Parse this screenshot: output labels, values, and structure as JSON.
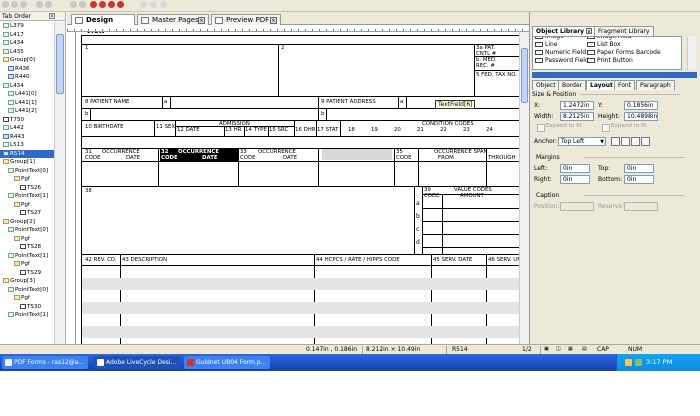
{
  "left_panel": {
    "tab": "Tab Order",
    "items": [
      "L379",
      "L417",
      "L434",
      "L435",
      "Group[0]",
      "R436",
      "R440",
      "L434",
      "L441[0]",
      "L441[1]",
      "L441[2]",
      "T750",
      "L442",
      "R443",
      "L513",
      "R514",
      "Group[1]",
      "PointText[0]",
      "Pgf",
      "TS26",
      "PointText[1]",
      "Pgf",
      "TS27",
      "Group[2]",
      "PointText[0]",
      "Pgf",
      "TS28",
      "PointText[1]",
      "Pgf",
      "TS29",
      "Group[3]",
      "PointText[0]",
      "Pgf",
      "TS30",
      "PointText[1]"
    ],
    "selected_index": 15
  },
  "tabs": [
    {
      "label": "Design View",
      "active": true
    },
    {
      "label": "Master Pages",
      "active": false
    },
    {
      "label": "Preview PDF",
      "active": false
    }
  ],
  "form": {
    "box1": "1",
    "box2": "2",
    "pat_cntl": "3a PAT. CNTL #",
    "med_rec": "b. MED. REC. #",
    "fed_tax": "5 FED. TAX NO.",
    "patient_name": "8 PATIENT NAME",
    "patient_address": "9 PATIENT ADDRESS",
    "a": "a",
    "b": "b",
    "c": "c",
    "d": "d",
    "birthdate": "10 BIRTHDATE",
    "sex": "11 SEX",
    "admission": "ADMISSION",
    "date12": "12 DATE",
    "hr13": "13 HR",
    "type14": "14 TYPE",
    "src15": "15 SRC",
    "dhr16": "16 DHR",
    "stat17": "17 STAT",
    "condition_codes": "CONDITION CODES",
    "cc_nums": [
      "18",
      "19",
      "20",
      "21",
      "22",
      "23",
      "24"
    ],
    "oc31_num": "31",
    "oc31": "OCCURRENCE",
    "code": "CODE",
    "date": "DATE",
    "oc32_num": "32",
    "oc32": "OCCURRENCE",
    "oc33_num": "33",
    "oc33": "OCCURRENCE",
    "oc35_num": "35",
    "occ_span": "OCCURRENCE SPAN",
    "from": "FROM",
    "through": "THROUGH",
    "box38": "38",
    "vc39_num": "39",
    "value_codes": "VALUE CODES",
    "amount": "AMOUNT",
    "rev_cd": "42 REV. CD.",
    "description": "43 DESCRIPTION",
    "hcpcs": "44 HCPCS / RATE / HIPPS CODE",
    "serv_date": "45 SERV. DATE",
    "serv_units": "46 SERV. UNIT",
    "tooltip": "TextField[6]"
  },
  "right_panel": {
    "lib_tabs": [
      "Object Library",
      "Fragment Library"
    ],
    "lib_items": [
      {
        "label": "Image",
        "col": 0
      },
      {
        "label": "Image Field",
        "col": 1
      },
      {
        "label": "Line",
        "col": 0
      },
      {
        "label": "List Box",
        "col": 1
      },
      {
        "label": "Numeric Field",
        "col": 0
      },
      {
        "label": "Paper Forms Barcode",
        "col": 1
      },
      {
        "label": "Password Field",
        "col": 0
      },
      {
        "label": "Print Button",
        "col": 1
      }
    ],
    "prop_tabs": [
      "Object",
      "Border",
      "Layout",
      "Font",
      "Paragraph"
    ],
    "active_prop_tab": "Layout",
    "size_position": "Size & Position",
    "x_label": "X:",
    "x_value": "1.2472in",
    "y_label": "Y:",
    "y_value": "0.1856in",
    "width_label": "Width:",
    "width_value": "8.2125in",
    "height_label": "Height:",
    "height_value": "10.4898in",
    "expand_fit": "Expand to fit",
    "anchor_label": "Anchor:",
    "anchor_value": "Top Left",
    "margins": "Margins",
    "left_label": "Left:",
    "left_value": "0in",
    "top_label": "Top:",
    "top_value": "0in",
    "right_label": "Right:",
    "right_value": "0in",
    "bottom_label": "Bottom:",
    "bottom_value": "0in",
    "caption": "Caption",
    "position_label": "Position:",
    "reserve_label": "Reserve:"
  },
  "statusbar": {
    "coords": "0.147in , 0.186in",
    "size": "8.212in × 10.49in",
    "field": "R514",
    "page": "1/2",
    "cap": "CAP",
    "num": "NUM"
  },
  "taskbar": {
    "tasks": [
      "PDF Forms - ras12@a...",
      "Adobe LiveCycle Desi...",
      "Guldnet UB04 Form.p..."
    ],
    "clock": "3:17 PM"
  },
  "colors": {
    "selection": "#316ac5",
    "taskbar": "#245edb",
    "chrome": "#ece9d8"
  }
}
